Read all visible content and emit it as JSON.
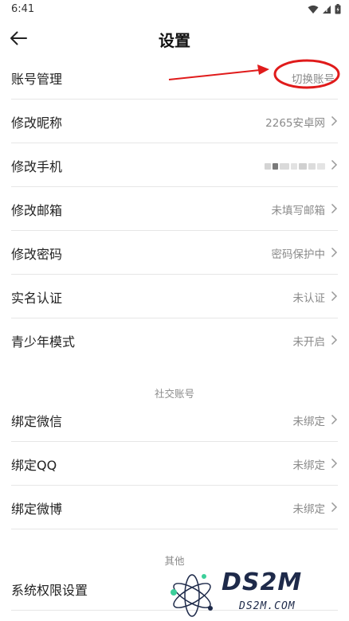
{
  "status_bar": {
    "time": "6:41"
  },
  "header": {
    "title": "设置"
  },
  "rows": [
    {
      "label": "账号管理",
      "value": "切换账号"
    },
    {
      "label": "修改昵称",
      "value": "2265安卓网"
    },
    {
      "label": "修改手机",
      "value": ""
    },
    {
      "label": "修改邮箱",
      "value": "未填写邮箱"
    },
    {
      "label": "修改密码",
      "value": "密码保护中"
    },
    {
      "label": "实名认证",
      "value": "未认证"
    },
    {
      "label": "青少年模式",
      "value": "未开启"
    }
  ],
  "social": {
    "header": "社交账号",
    "rows": [
      {
        "label": "绑定微信",
        "value": "未绑定"
      },
      {
        "label": "绑定QQ",
        "value": "未绑定"
      },
      {
        "label": "绑定微博",
        "value": "未绑定"
      }
    ]
  },
  "other": {
    "header": "其他",
    "rows": [
      {
        "label": "系统权限设置"
      }
    ]
  },
  "watermark": {
    "logo": "DS2M",
    "domain": "DS2M.COM"
  },
  "colors": {
    "annotation": "#e01b1b",
    "divider": "#e6e6e6",
    "secondary_text": "#8a8a8a"
  },
  "icons": {
    "back": "arrow-left-icon",
    "chevron": "chevron-right-icon",
    "wifi": "wifi-icon",
    "signal": "signal-icon",
    "battery": "battery-icon"
  }
}
